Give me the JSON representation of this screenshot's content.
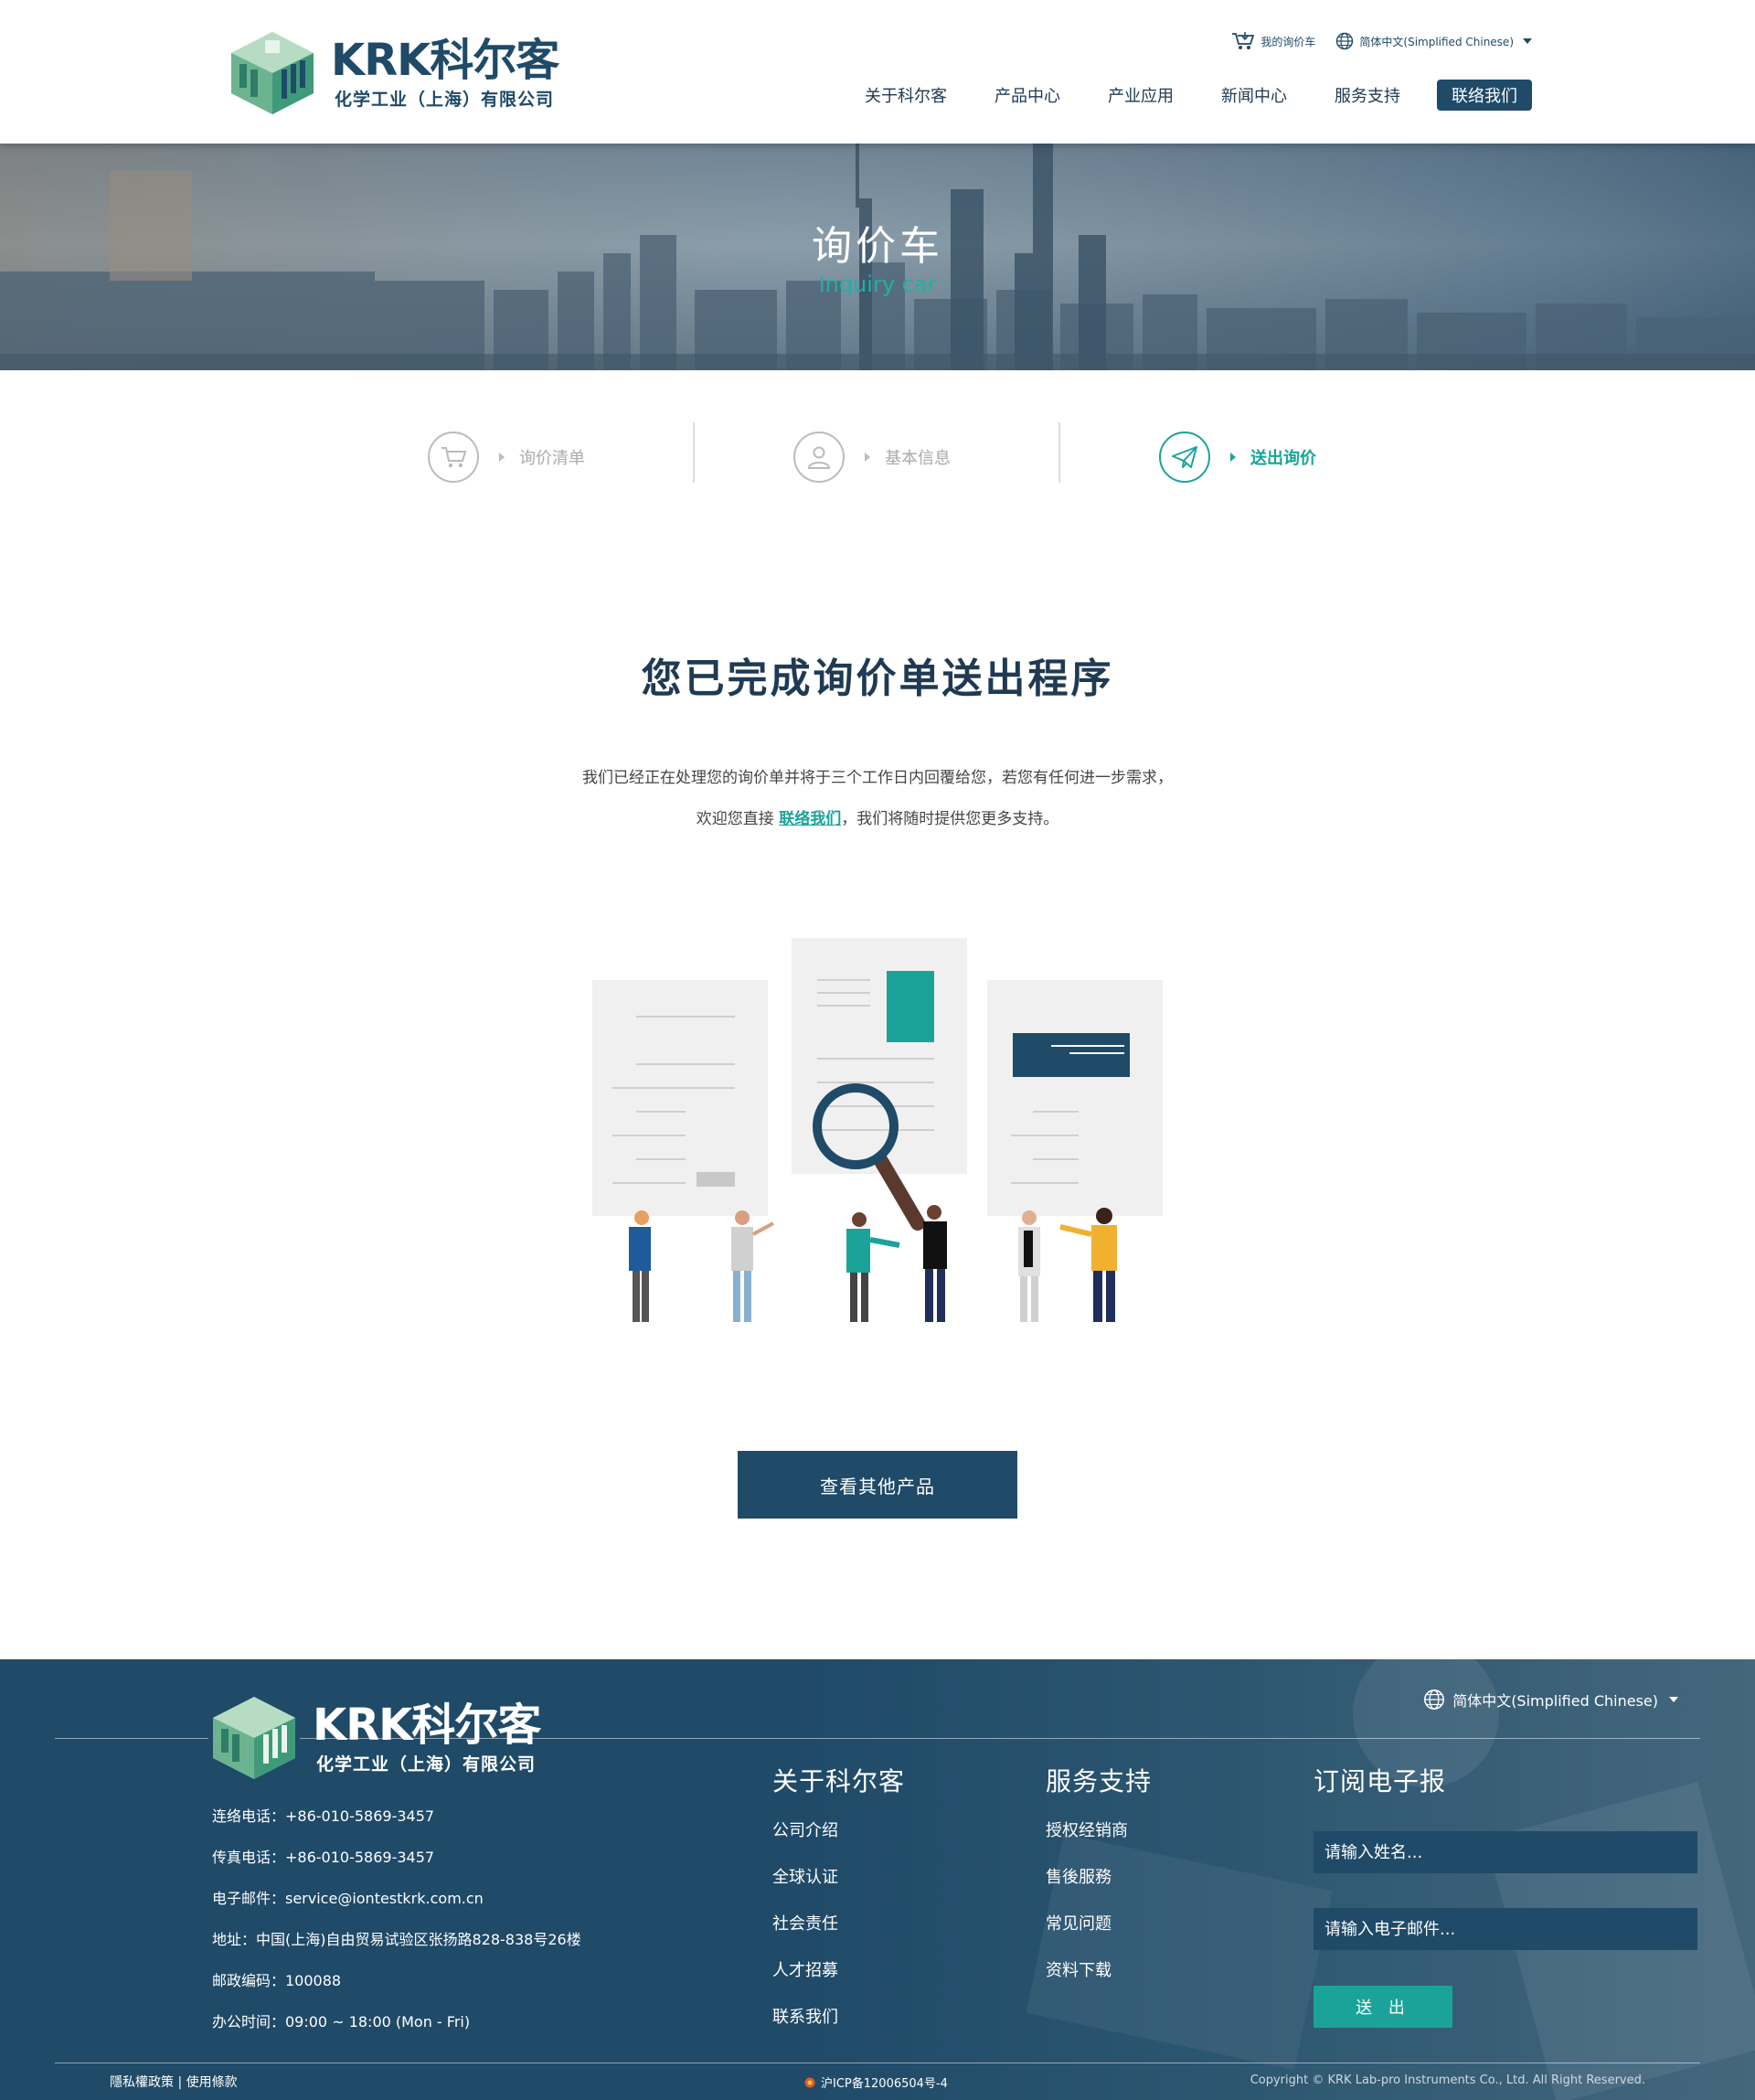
{
  "header": {
    "logo_text": "KRK科尔客",
    "logo_sub": "化学工业（上海）有限公司",
    "cart_label": "我的询价车",
    "lang_label": "简体中文(Simplified Chinese)",
    "nav": [
      "关于科尔客",
      "产品中心",
      "产业应用",
      "新闻中心",
      "服务支持"
    ],
    "contact_label": "联络我们"
  },
  "banner": {
    "title": "询价车",
    "subtitle": "Inquiry car"
  },
  "steps": [
    {
      "label": "询价清单",
      "icon": "cart-icon",
      "active": false
    },
    {
      "label": "基本信息",
      "icon": "user-icon",
      "active": false
    },
    {
      "label": "送出询价",
      "icon": "paper-plane-icon",
      "active": true
    }
  ],
  "main": {
    "title": "您已完成询价单送出程序",
    "line1": "我们已经正在处理您的询价单并将于三个工作日内回覆给您，若您有任何进一步需求，",
    "line2_before": "欢迎您直接",
    "line2_link": "联络我们",
    "line2_after": "，我们将随时提供您更多支持。",
    "cta": "查看其他产品"
  },
  "footer": {
    "logo_text": "KRK科尔客",
    "logo_sub": "化学工业（上海）有限公司",
    "lang_label": "简体中文(Simplified Chinese)",
    "contact": {
      "phone": "连络电话：+86-010-5869-3457",
      "fax": "传真电话：+86-010-5869-3457",
      "email": "电子邮件：service@iontestkrk.com.cn",
      "address": "地址：中国(上海)自由贸易试验区张扬路828-838号26楼",
      "zip": "邮政编码：100088",
      "hours": "办公时间：09:00 ~ 18:00 (Mon - Fri)"
    },
    "about": {
      "title": "关于科尔客",
      "links": [
        "公司介绍",
        "全球认证",
        "社会责任",
        "人才招募",
        "联系我们"
      ]
    },
    "service": {
      "title": "服务支持",
      "links": [
        "授权经销商",
        "售後服務",
        "常见问题",
        "资料下载"
      ]
    },
    "newsletter": {
      "title": "订阅电子报",
      "name_placeholder": "请输入姓名...",
      "email_placeholder": "请输入电子邮件...",
      "submit": "送 出"
    },
    "bottom": {
      "policy": "隱私權政策 | 使用條款",
      "icp": "沪ICP备12006504号-4",
      "copyright": "Copyright © KRK Lab-pro Instruments Co., Ltd. All Right Reserved."
    }
  },
  "colors": {
    "navy": "#1f4a68",
    "teal": "#1ba39a"
  }
}
